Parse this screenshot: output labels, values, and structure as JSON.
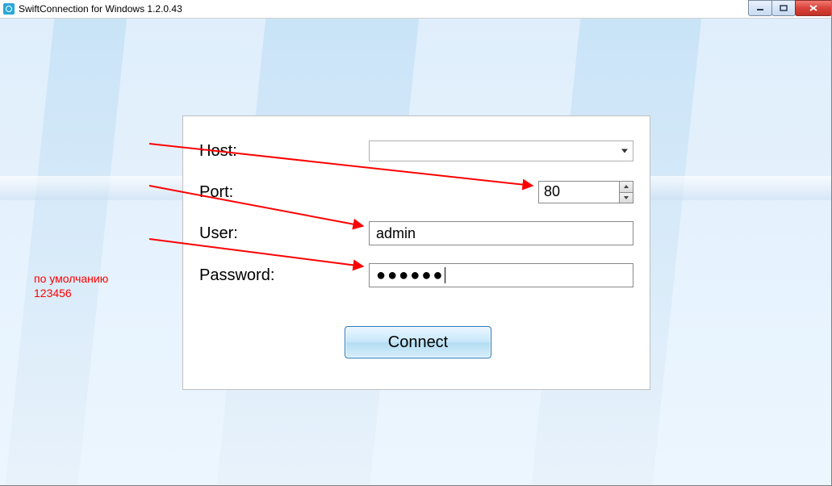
{
  "window": {
    "title": "SwiftConnection for Windows 1.2.0.43"
  },
  "form": {
    "host_label": "Host:",
    "host_value": "",
    "port_label": "Port:",
    "port_value": "80",
    "user_label": "User:",
    "user_value": "admin",
    "password_label": "Password:",
    "password_mask": "●●●●●●",
    "connect_label": "Connect"
  },
  "annotation": {
    "line1": "по умолчанию",
    "line2": "123456"
  }
}
